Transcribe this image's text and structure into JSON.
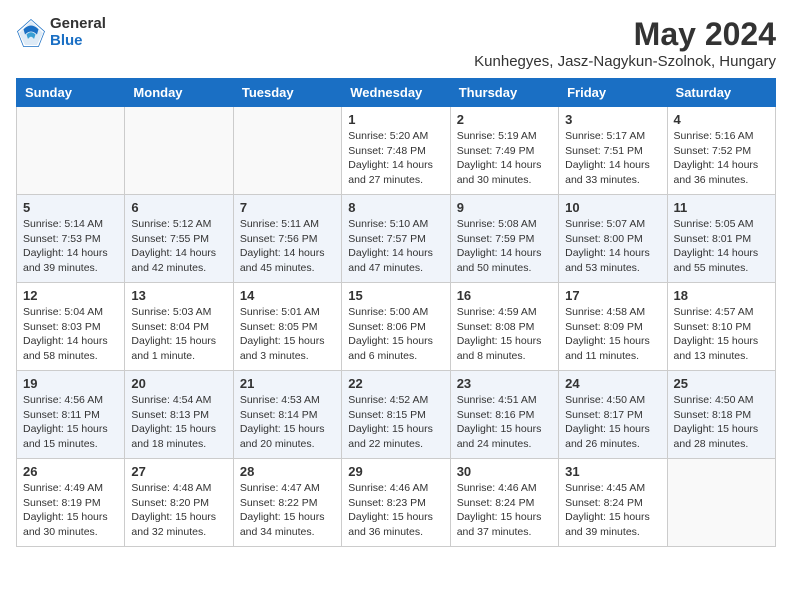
{
  "header": {
    "logo_general": "General",
    "logo_blue": "Blue",
    "month_title": "May 2024",
    "location": "Kunhegyes, Jasz-Nagykun-Szolnok, Hungary"
  },
  "days_of_week": [
    "Sunday",
    "Monday",
    "Tuesday",
    "Wednesday",
    "Thursday",
    "Friday",
    "Saturday"
  ],
  "weeks": [
    [
      {
        "day": "",
        "info": ""
      },
      {
        "day": "",
        "info": ""
      },
      {
        "day": "",
        "info": ""
      },
      {
        "day": "1",
        "sunrise": "Sunrise: 5:20 AM",
        "sunset": "Sunset: 7:48 PM",
        "daylight": "Daylight: 14 hours and 27 minutes."
      },
      {
        "day": "2",
        "sunrise": "Sunrise: 5:19 AM",
        "sunset": "Sunset: 7:49 PM",
        "daylight": "Daylight: 14 hours and 30 minutes."
      },
      {
        "day": "3",
        "sunrise": "Sunrise: 5:17 AM",
        "sunset": "Sunset: 7:51 PM",
        "daylight": "Daylight: 14 hours and 33 minutes."
      },
      {
        "day": "4",
        "sunrise": "Sunrise: 5:16 AM",
        "sunset": "Sunset: 7:52 PM",
        "daylight": "Daylight: 14 hours and 36 minutes."
      }
    ],
    [
      {
        "day": "5",
        "sunrise": "Sunrise: 5:14 AM",
        "sunset": "Sunset: 7:53 PM",
        "daylight": "Daylight: 14 hours and 39 minutes."
      },
      {
        "day": "6",
        "sunrise": "Sunrise: 5:12 AM",
        "sunset": "Sunset: 7:55 PM",
        "daylight": "Daylight: 14 hours and 42 minutes."
      },
      {
        "day": "7",
        "sunrise": "Sunrise: 5:11 AM",
        "sunset": "Sunset: 7:56 PM",
        "daylight": "Daylight: 14 hours and 45 minutes."
      },
      {
        "day": "8",
        "sunrise": "Sunrise: 5:10 AM",
        "sunset": "Sunset: 7:57 PM",
        "daylight": "Daylight: 14 hours and 47 minutes."
      },
      {
        "day": "9",
        "sunrise": "Sunrise: 5:08 AM",
        "sunset": "Sunset: 7:59 PM",
        "daylight": "Daylight: 14 hours and 50 minutes."
      },
      {
        "day": "10",
        "sunrise": "Sunrise: 5:07 AM",
        "sunset": "Sunset: 8:00 PM",
        "daylight": "Daylight: 14 hours and 53 minutes."
      },
      {
        "day": "11",
        "sunrise": "Sunrise: 5:05 AM",
        "sunset": "Sunset: 8:01 PM",
        "daylight": "Daylight: 14 hours and 55 minutes."
      }
    ],
    [
      {
        "day": "12",
        "sunrise": "Sunrise: 5:04 AM",
        "sunset": "Sunset: 8:03 PM",
        "daylight": "Daylight: 14 hours and 58 minutes."
      },
      {
        "day": "13",
        "sunrise": "Sunrise: 5:03 AM",
        "sunset": "Sunset: 8:04 PM",
        "daylight": "Daylight: 15 hours and 1 minute."
      },
      {
        "day": "14",
        "sunrise": "Sunrise: 5:01 AM",
        "sunset": "Sunset: 8:05 PM",
        "daylight": "Daylight: 15 hours and 3 minutes."
      },
      {
        "day": "15",
        "sunrise": "Sunrise: 5:00 AM",
        "sunset": "Sunset: 8:06 PM",
        "daylight": "Daylight: 15 hours and 6 minutes."
      },
      {
        "day": "16",
        "sunrise": "Sunrise: 4:59 AM",
        "sunset": "Sunset: 8:08 PM",
        "daylight": "Daylight: 15 hours and 8 minutes."
      },
      {
        "day": "17",
        "sunrise": "Sunrise: 4:58 AM",
        "sunset": "Sunset: 8:09 PM",
        "daylight": "Daylight: 15 hours and 11 minutes."
      },
      {
        "day": "18",
        "sunrise": "Sunrise: 4:57 AM",
        "sunset": "Sunset: 8:10 PM",
        "daylight": "Daylight: 15 hours and 13 minutes."
      }
    ],
    [
      {
        "day": "19",
        "sunrise": "Sunrise: 4:56 AM",
        "sunset": "Sunset: 8:11 PM",
        "daylight": "Daylight: 15 hours and 15 minutes."
      },
      {
        "day": "20",
        "sunrise": "Sunrise: 4:54 AM",
        "sunset": "Sunset: 8:13 PM",
        "daylight": "Daylight: 15 hours and 18 minutes."
      },
      {
        "day": "21",
        "sunrise": "Sunrise: 4:53 AM",
        "sunset": "Sunset: 8:14 PM",
        "daylight": "Daylight: 15 hours and 20 minutes."
      },
      {
        "day": "22",
        "sunrise": "Sunrise: 4:52 AM",
        "sunset": "Sunset: 8:15 PM",
        "daylight": "Daylight: 15 hours and 22 minutes."
      },
      {
        "day": "23",
        "sunrise": "Sunrise: 4:51 AM",
        "sunset": "Sunset: 8:16 PM",
        "daylight": "Daylight: 15 hours and 24 minutes."
      },
      {
        "day": "24",
        "sunrise": "Sunrise: 4:50 AM",
        "sunset": "Sunset: 8:17 PM",
        "daylight": "Daylight: 15 hours and 26 minutes."
      },
      {
        "day": "25",
        "sunrise": "Sunrise: 4:50 AM",
        "sunset": "Sunset: 8:18 PM",
        "daylight": "Daylight: 15 hours and 28 minutes."
      }
    ],
    [
      {
        "day": "26",
        "sunrise": "Sunrise: 4:49 AM",
        "sunset": "Sunset: 8:19 PM",
        "daylight": "Daylight: 15 hours and 30 minutes."
      },
      {
        "day": "27",
        "sunrise": "Sunrise: 4:48 AM",
        "sunset": "Sunset: 8:20 PM",
        "daylight": "Daylight: 15 hours and 32 minutes."
      },
      {
        "day": "28",
        "sunrise": "Sunrise: 4:47 AM",
        "sunset": "Sunset: 8:22 PM",
        "daylight": "Daylight: 15 hours and 34 minutes."
      },
      {
        "day": "29",
        "sunrise": "Sunrise: 4:46 AM",
        "sunset": "Sunset: 8:23 PM",
        "daylight": "Daylight: 15 hours and 36 minutes."
      },
      {
        "day": "30",
        "sunrise": "Sunrise: 4:46 AM",
        "sunset": "Sunset: 8:24 PM",
        "daylight": "Daylight: 15 hours and 37 minutes."
      },
      {
        "day": "31",
        "sunrise": "Sunrise: 4:45 AM",
        "sunset": "Sunset: 8:24 PM",
        "daylight": "Daylight: 15 hours and 39 minutes."
      },
      {
        "day": "",
        "info": ""
      }
    ]
  ]
}
